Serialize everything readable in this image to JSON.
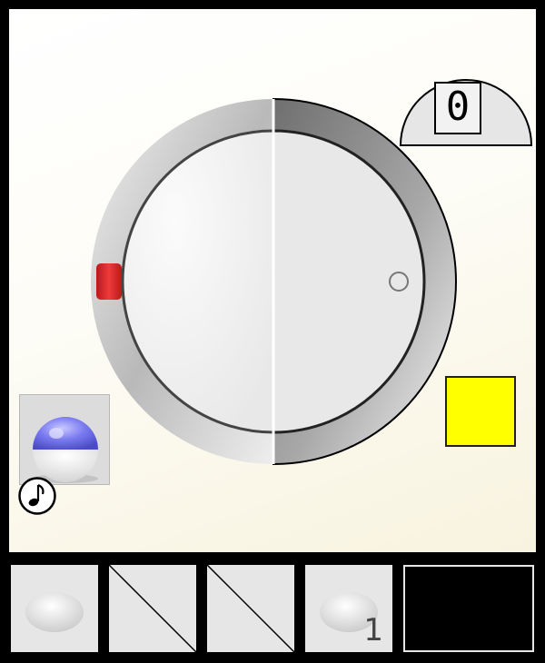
{
  "counter": {
    "value": "0"
  },
  "dial": {
    "marker_color": "#e02a2a",
    "selector_icon": "circle-marker-icon"
  },
  "indicator": {
    "color": "#ffff00"
  },
  "orb_tile": {
    "icon": "blue-white-orb-icon"
  },
  "music": {
    "icon": "music-note-icon"
  },
  "inventory": {
    "slots": [
      {
        "item": "white-pebble",
        "count": ""
      },
      {
        "item": "empty",
        "count": ""
      },
      {
        "item": "empty",
        "count": ""
      },
      {
        "item": "white-pebble",
        "count": "1"
      }
    ],
    "map_panel": {
      "color": "#000000"
    }
  }
}
